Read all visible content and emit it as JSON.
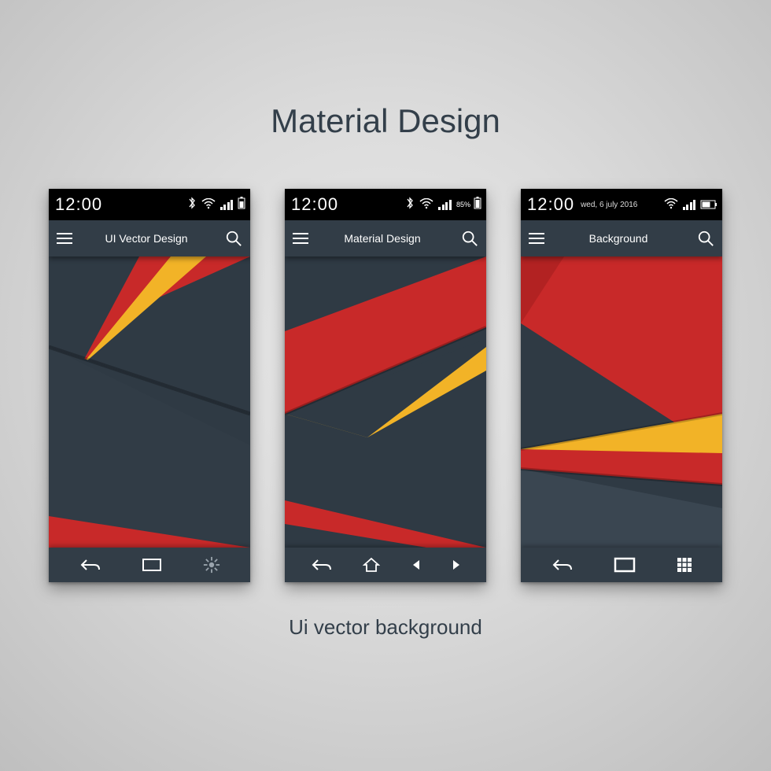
{
  "title": "Material Design",
  "subtitle": "Ui vector background",
  "colors": {
    "red": "#c82929",
    "yellow": "#f2b327",
    "slate": "#2f3a44",
    "slate_light": "#3a4651"
  },
  "phones": [
    {
      "time": "12:00",
      "date": "",
      "battery_pct": "",
      "app_title": "UI Vector Design",
      "nav": [
        "back",
        "square",
        "gear"
      ]
    },
    {
      "time": "12:00",
      "date": "",
      "battery_pct": "85%",
      "app_title": "Material Design",
      "nav": [
        "back",
        "home",
        "left",
        "right"
      ]
    },
    {
      "time": "12:00",
      "date": "wed, 6 july 2016",
      "battery_pct": "",
      "app_title": "Background",
      "nav": [
        "back",
        "rect",
        "apps"
      ]
    }
  ]
}
